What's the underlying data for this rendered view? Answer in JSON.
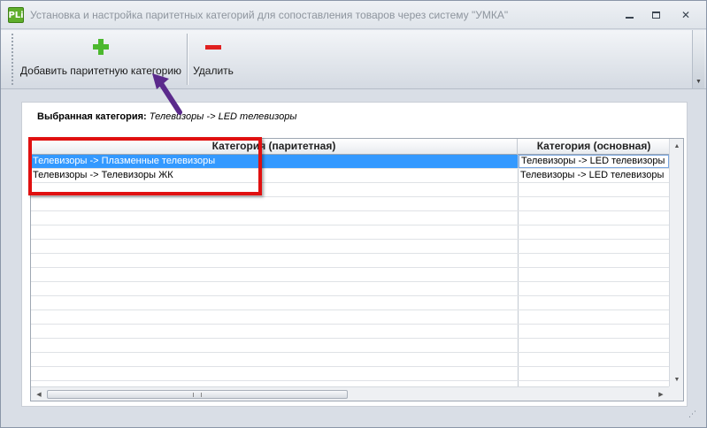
{
  "window": {
    "title": "Установка и настройка паритетных категорий для сопоставления товаров через систему \"УМКА\"",
    "app_icon_text": "PLi"
  },
  "toolbar": {
    "add_label": "Добавить паритетную категорию",
    "delete_label": "Удалить"
  },
  "selection": {
    "label": "Выбранная категория:",
    "value": "Телевизоры -> LED телевизоры"
  },
  "grid": {
    "columns": [
      "Категория (паритетная)",
      "Категория (основная)"
    ],
    "rows": [
      {
        "parity": "Телевизоры -> Плазменные телевизоры",
        "main": "Телевизоры -> LED телевизоры",
        "selected": true
      },
      {
        "parity": "Телевизоры -> Телевизоры ЖК",
        "main": "Телевизоры -> LED телевизоры",
        "selected": false
      }
    ],
    "empty_rows": 15
  },
  "colors": {
    "selection": "#3399ff",
    "annotation_box": "#e01010",
    "annotation_arrow": "#5b2a8c",
    "add_icon": "#4cb82e",
    "delete_icon": "#e02020"
  },
  "icons": {
    "add": "plus-icon",
    "delete": "minus-icon",
    "minimize": "minimize-icon",
    "maximize": "maximize-icon",
    "close": "close-icon"
  }
}
